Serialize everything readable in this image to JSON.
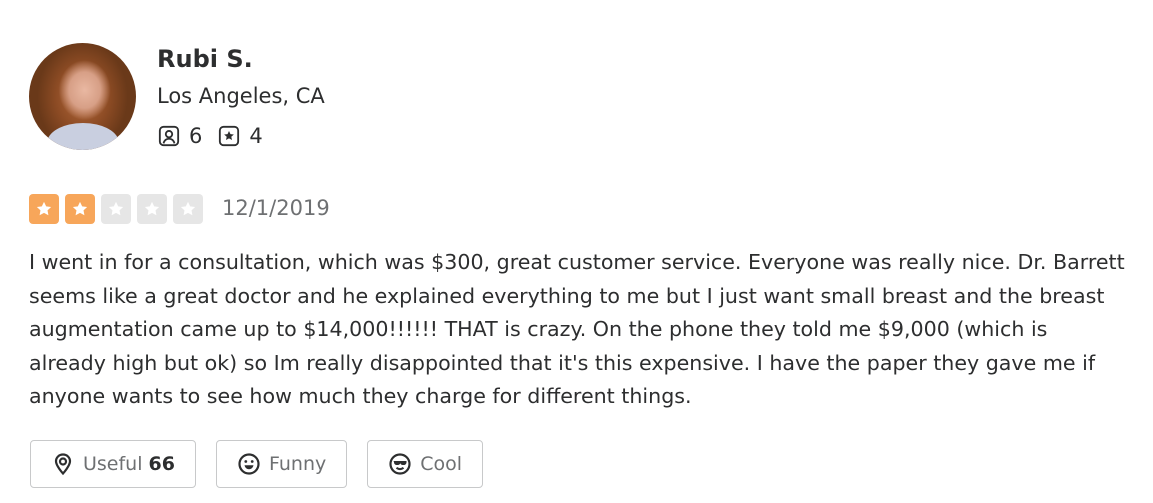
{
  "user": {
    "name": "Rubi S.",
    "location": "Los Angeles, CA",
    "friends_count": "6",
    "reviews_count": "4"
  },
  "review": {
    "rating": 2,
    "rating_max": 5,
    "date": "12/1/2019",
    "text": "I went in for a consultation, which was $300, great customer service. Everyone was really nice. Dr. Barrett seems like a great doctor and he explained everything to me but I just want small breast and the breast augmentation came up to $14,000!!!!!! THAT is crazy. On the phone they told me $9,000 (which is already high but ok) so Im really disappointed that it's this expensive. I have the paper they gave me if anyone wants to see how much they charge for different things."
  },
  "reactions": {
    "useful_label": "Useful",
    "useful_count": "66",
    "funny_label": "Funny",
    "cool_label": "Cool"
  },
  "colors": {
    "star_on": "#f7a65a",
    "star_off": "#e6e6e6",
    "text": "#2d2e2f",
    "muted": "#6e7072"
  },
  "icons": {
    "friends": "friends-icon",
    "reviews": "star-badge-icon",
    "useful": "lightbulb-icon",
    "funny": "smile-icon",
    "cool": "sunglasses-icon"
  }
}
